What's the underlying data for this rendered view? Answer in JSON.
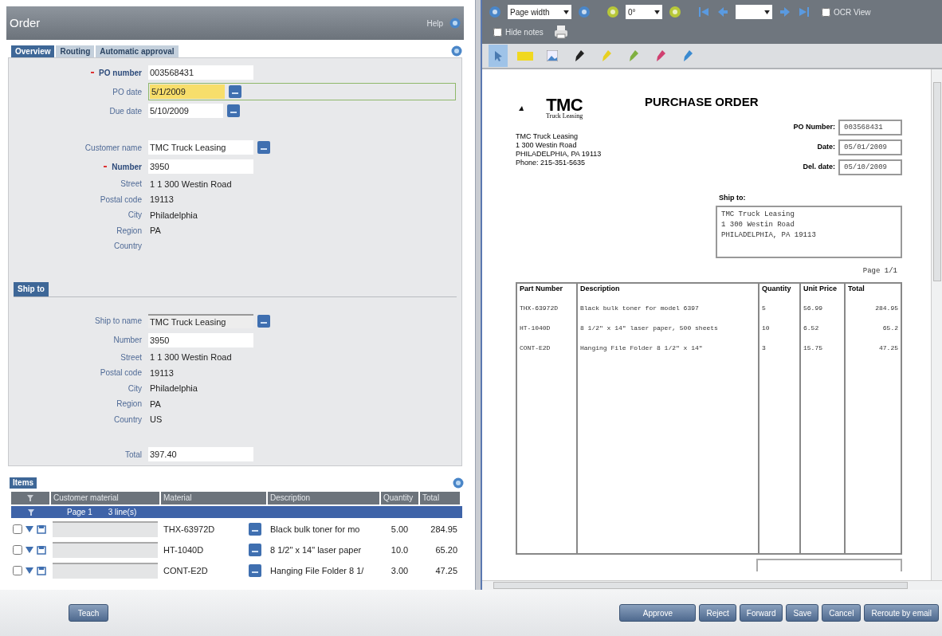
{
  "order_panel": {
    "title": "Order",
    "help": "Help",
    "tabs": [
      {
        "label": "Overview",
        "selected": true
      },
      {
        "label": "Routing",
        "selected": false
      },
      {
        "label": "Automatic approval",
        "selected": false
      }
    ],
    "field_groups": [
      [
        {
          "label": "PO number",
          "kind": "input",
          "value": "003568431",
          "required": true,
          "focused": false
        },
        {
          "label": "PO date",
          "kind": "date",
          "value": "5/1/2009",
          "required": false,
          "focused": true
        },
        {
          "label": "Due date",
          "kind": "date",
          "value": "5/10/2009",
          "required": false,
          "focused": false
        }
      ],
      [
        {
          "label": "Customer name",
          "kind": "lookup",
          "value": "TMC Truck Leasing",
          "required": false,
          "focused": false
        },
        {
          "label": "Number",
          "kind": "input",
          "value": "3950",
          "required": true,
          "focused": false
        },
        {
          "label": "Street",
          "kind": "text",
          "value": "1 1 300 Westin Road",
          "required": false,
          "focused": false
        },
        {
          "label": "Postal code",
          "kind": "text",
          "value": "19113",
          "required": false,
          "focused": false
        },
        {
          "label": "City",
          "kind": "text",
          "value": "Philadelphia",
          "required": false,
          "focused": false
        },
        {
          "label": "Region",
          "kind": "text",
          "value": "PA",
          "required": false,
          "focused": false
        },
        {
          "label": "Country",
          "kind": "text",
          "required": false,
          "focused": false
        }
      ]
    ],
    "ship_to": {
      "title": "Ship to",
      "field_groups": [
        [
          {
            "label": "Ship to name",
            "kind": "lookup",
            "value": "TMC Truck Leasing",
            "required": false,
            "focused": false
          },
          {
            "label": "Number",
            "kind": "input",
            "value": "3950",
            "required": false,
            "focused": false
          },
          {
            "label": "Street",
            "kind": "text",
            "value": "1 1 300 Westin Road",
            "required": false,
            "focused": false
          },
          {
            "label": "Postal code",
            "kind": "text",
            "value": "19113",
            "required": false,
            "focused": false
          },
          {
            "label": "City",
            "kind": "text",
            "value": "Philadelphia",
            "required": false,
            "focused": false
          },
          {
            "label": "Region",
            "kind": "text",
            "value": "PA",
            "required": false,
            "focused": false
          },
          {
            "label": "Country",
            "kind": "text",
            "value": "US",
            "required": false,
            "focused": false
          }
        ],
        [
          {
            "label": "Total",
            "kind": "input",
            "value": "397.40",
            "required": false,
            "focused": false
          }
        ]
      ]
    },
    "items": {
      "title": "Items",
      "columns": [
        "Customer material",
        "Material",
        "Description",
        "Quantity",
        "Total"
      ],
      "group_row": {
        "page": "Page 1",
        "lines": "3 line(s)"
      },
      "rows": [
        {
          "checked": false,
          "material": "THX-63972D",
          "description": "Black bulk toner for mo",
          "quantity": "5.00",
          "total": "284.95"
        },
        {
          "checked": false,
          "material": "HT-1040D",
          "description": "8 1/2\" x 14\" laser paper",
          "quantity": "10.0",
          "total": "65.20"
        },
        {
          "checked": false,
          "material": "CONT-E2D",
          "description": "Hanging File Folder 8 1/",
          "quantity": "3.00",
          "total": "47.25"
        }
      ]
    }
  },
  "viewer": {
    "toolbar": {
      "zoom": "Page width",
      "rotation": "0°",
      "ocr_view": {
        "label": "OCR View",
        "checked": false
      },
      "hide_notes": {
        "label": "Hide notes",
        "checked": false
      }
    },
    "annotation_tools": [
      {
        "kind": "pointer",
        "selected": true
      },
      {
        "kind": "note",
        "selected": false
      },
      {
        "kind": "image",
        "selected": false
      },
      {
        "kind": "marker",
        "color": "#222222",
        "selected": false
      },
      {
        "kind": "marker",
        "color": "#e8d020",
        "selected": false
      },
      {
        "kind": "marker",
        "color": "#7fb040",
        "selected": false
      },
      {
        "kind": "marker",
        "color": "#d04070",
        "selected": false
      },
      {
        "kind": "marker",
        "color": "#3a8ad0",
        "selected": false
      }
    ],
    "document": {
      "logo": "TMC",
      "logo_sub": "Truck Leasing",
      "title": "PURCHASE ORDER",
      "address": [
        "TMC Truck Leasing",
        "1 300 Westin Road",
        "PHILADELPHIA, PA 19113",
        "Phone: 215-351-5635"
      ],
      "fields": [
        {
          "label": "PO Number:",
          "value": "003568431"
        },
        {
          "label": "Date:",
          "value": "05/01/2009"
        },
        {
          "label": "Del. date:",
          "value": "05/10/2009"
        }
      ],
      "ship_to_label": "Ship to:",
      "ship_to": [
        "TMC Truck Leasing",
        "1 300 Westin Road",
        "PHILADELPHIA, PA 19113"
      ],
      "page": "Page 1/1",
      "columns": [
        "Part Number",
        "Description",
        "Quantity",
        "Unit Price",
        "Total"
      ],
      "rows": [
        [
          "THX-63972D",
          "Black bulk toner for model 6397",
          "5",
          "56.99",
          "284.95"
        ],
        [
          "HT-1040D",
          "8 1/2\" x 14\" laser paper, 500 sheets",
          "10",
          "6.52",
          "65.2"
        ],
        [
          "CONT-E2D",
          "Hanging File Folder 8 1/2\" x 14\"",
          "3",
          "15.75",
          "47.25"
        ]
      ]
    }
  },
  "footer": {
    "left_buttons": [
      "Teach"
    ],
    "right_buttons": [
      "Approve",
      "Reject",
      "Forward",
      "Save",
      "Cancel",
      "Reroute by email"
    ]
  }
}
